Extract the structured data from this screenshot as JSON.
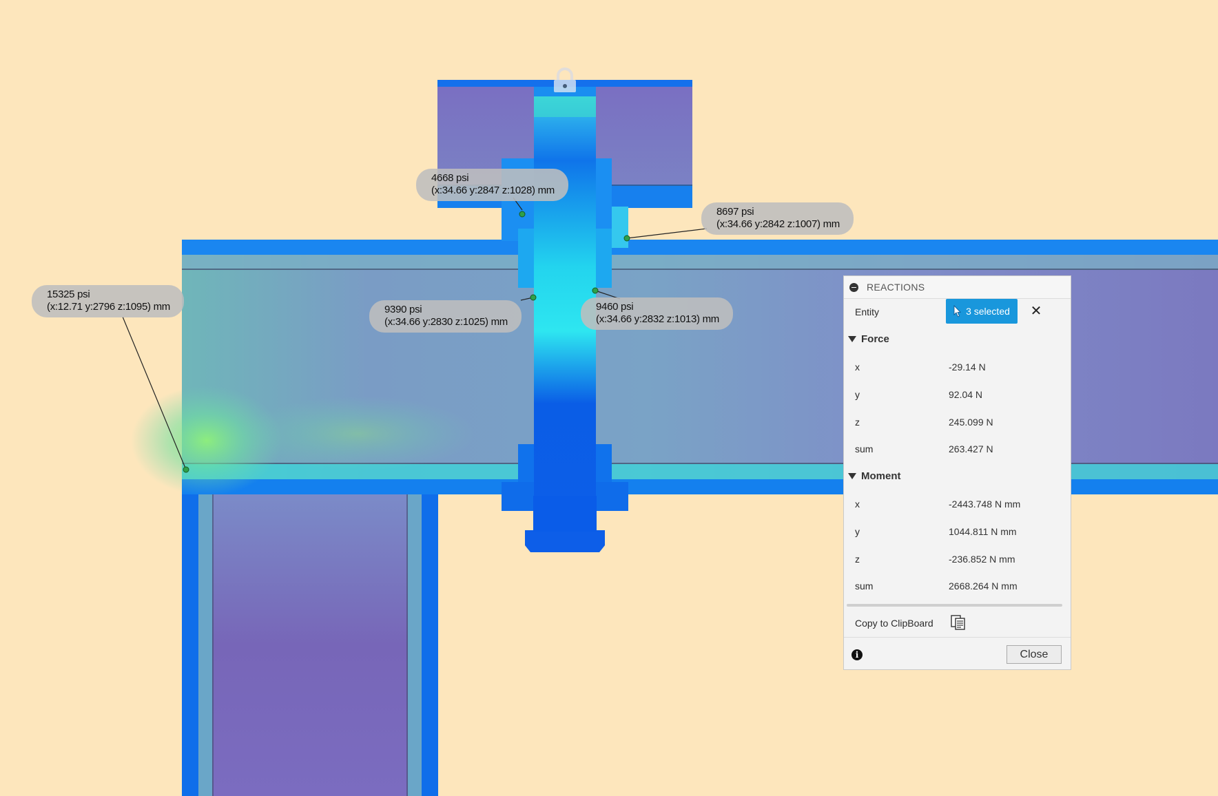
{
  "probes": [
    {
      "id": "p1",
      "value": "4668 psi",
      "coords": "(x:34.66 y:2847 z:1028) mm"
    },
    {
      "id": "p2",
      "value": "8697 psi",
      "coords": "(x:34.66 y:2842 z:1007) mm"
    },
    {
      "id": "p3",
      "value": "15325 psi",
      "coords": "(x:12.71 y:2796 z:1095) mm"
    },
    {
      "id": "p4",
      "value": "9390 psi",
      "coords": "(x:34.66 y:2830 z:1025) mm"
    },
    {
      "id": "p5",
      "value": "9460 psi",
      "coords": "(x:34.66 y:2832 z:1013) mm"
    }
  ],
  "panel": {
    "title": "REACTIONS",
    "entity_label": "Entity",
    "selection": "3 selected",
    "force": {
      "label": "Force",
      "rows": [
        {
          "axis": "x",
          "value": "-29.14 N"
        },
        {
          "axis": "y",
          "value": "92.04 N"
        },
        {
          "axis": "z",
          "value": "245.099 N"
        },
        {
          "axis": "sum",
          "value": "263.427 N"
        }
      ]
    },
    "moment": {
      "label": "Moment",
      "rows": [
        {
          "axis": "x",
          "value": "-2443.748 N mm"
        },
        {
          "axis": "y",
          "value": "1044.811 N mm"
        },
        {
          "axis": "z",
          "value": "-236.852 N mm"
        },
        {
          "axis": "sum",
          "value": "2668.264 N mm"
        }
      ]
    },
    "copy_label": "Copy to ClipBoard",
    "close_label": "Close"
  },
  "icons": {
    "collapse": "minus-circle-icon",
    "cursor": "pointer-cursor-icon",
    "clear": "close-x-icon",
    "clipboard": "clipboard-icon",
    "info": "info-icon",
    "lock": "lock-icon"
  },
  "colors": {
    "background": "#fde6bc",
    "accent": "#1997dc",
    "stress_low": "#0a6ee8",
    "stress_mid": "#22d6ee",
    "stress_high": "#7ff07a",
    "stress_min_fill": "#7b6cc0"
  }
}
